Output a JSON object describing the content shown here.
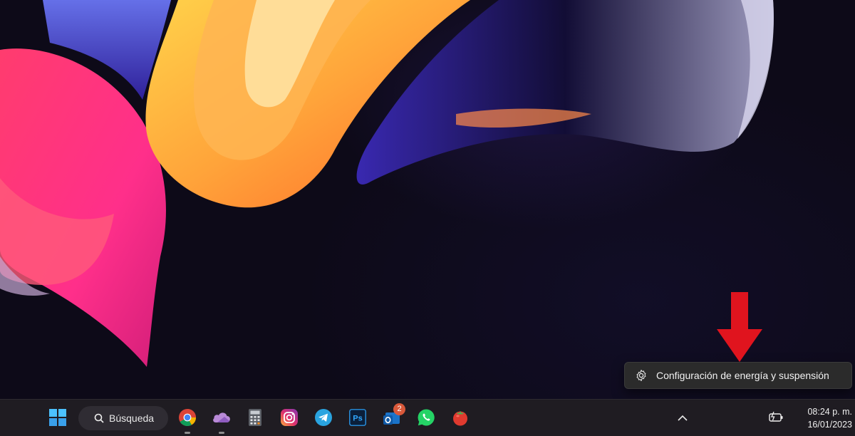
{
  "context_menu": {
    "icon": "gear-icon",
    "label": "Configuración de energía y suspensión"
  },
  "taskbar": {
    "search": {
      "icon": "search-icon",
      "label": "Búsqueda"
    },
    "apps": [
      {
        "name": "chrome",
        "running": true
      },
      {
        "name": "onedrive",
        "running": true
      },
      {
        "name": "calculator",
        "running": false
      },
      {
        "name": "instagram",
        "running": false
      },
      {
        "name": "telegram",
        "running": false
      },
      {
        "name": "photoshop",
        "label": "Ps",
        "running": false
      },
      {
        "name": "outlook",
        "badge": "2",
        "running": false
      },
      {
        "name": "whatsapp",
        "running": false
      },
      {
        "name": "tomato-timer",
        "running": false
      }
    ],
    "tray": {
      "chevron_icon": "chevron-up-icon",
      "battery_icon": "battery-charging-icon",
      "time": "08:24 p. m.",
      "date": "16/01/2023"
    }
  },
  "annotations": {
    "arrow_color": "#e0141e"
  }
}
